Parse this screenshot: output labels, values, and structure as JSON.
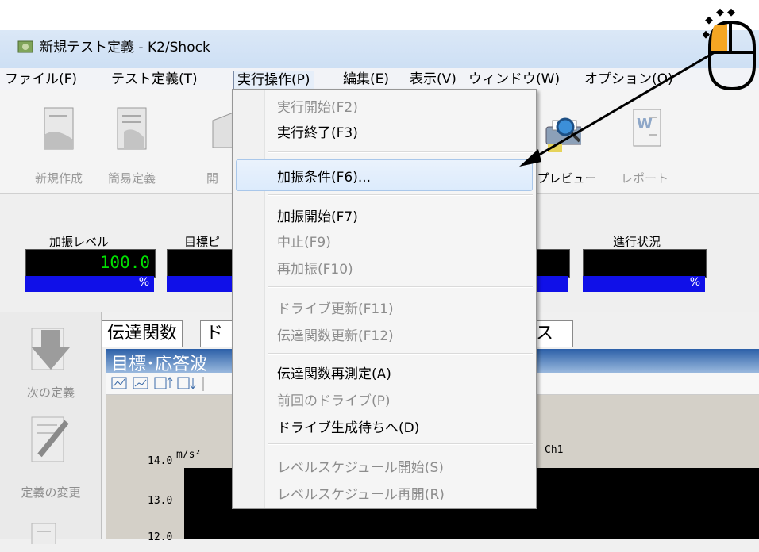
{
  "window": {
    "title": "新規テスト定義 - K2/Shock"
  },
  "menubar": {
    "items": [
      "ファイル(F)",
      "テスト定義(T)",
      "実行操作(P)",
      "編集(E)",
      "表示(V)",
      "ウィンドウ(W)",
      "オプション(O)"
    ]
  },
  "toolbar": {
    "new": "新規作成",
    "simple": "簡易定義",
    "open": "開",
    "preview": "プレビュー",
    "report": "レポート"
  },
  "status": {
    "level_label": "加振レベル",
    "level_value": "100.0",
    "level_unit": "%",
    "target_label": "目標ピ",
    "progress_label": "進行状況",
    "progress_unit": "%"
  },
  "sidebar": {
    "next": "次の定義",
    "change": "定義の変更"
  },
  "tabs": {
    "tab1": "伝達関数",
    "tab2": "ド",
    "tab3": "ス"
  },
  "plot": {
    "title": "目標･応答波",
    "channel": "Ch1",
    "unit": "m/s²",
    "ticks": [
      "14.0",
      "13.0",
      "12.0"
    ]
  },
  "dropdown": {
    "items": [
      {
        "label": "実行開始(F2)",
        "enabled": false
      },
      {
        "label": "実行終了(F3)",
        "enabled": true
      },
      {
        "label": "加振条件(F6)...",
        "enabled": true
      },
      {
        "label": "加振開始(F7)",
        "enabled": true
      },
      {
        "label": "中止(F9)",
        "enabled": false
      },
      {
        "label": "再加振(F10)",
        "enabled": false
      },
      {
        "label": "ドライブ更新(F11)",
        "enabled": false
      },
      {
        "label": "伝達関数更新(F12)",
        "enabled": false
      },
      {
        "label": "伝達関数再測定(A)",
        "enabled": true
      },
      {
        "label": "前回のドライブ(P)",
        "enabled": false
      },
      {
        "label": "ドライブ生成待ちへ(D)",
        "enabled": true
      },
      {
        "label": "レベルスケジュール開始(S)",
        "enabled": false
      },
      {
        "label": "レベルスケジュール再開(R)",
        "enabled": false
      }
    ]
  },
  "colors": {
    "accent": "#1010e8",
    "gauge_text": "#00e000",
    "mouse_icon": "#f5a623"
  }
}
